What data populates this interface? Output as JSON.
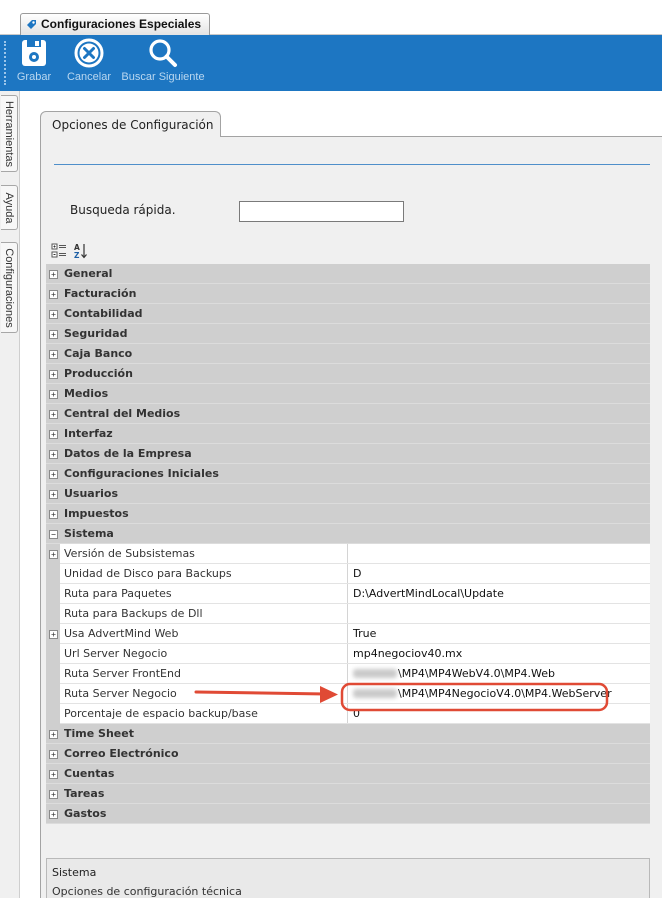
{
  "window": {
    "tab_title": "Configuraciones Especiales"
  },
  "toolbar": {
    "save_label": "Grabar",
    "cancel_label": "Cancelar",
    "find_next_label": "Buscar Siguiente"
  },
  "left_dock": {
    "tabs": [
      "Herramientas",
      "Ayuda",
      "Configuraciones"
    ]
  },
  "options_tab": {
    "title": "Opciones de Configuración"
  },
  "search": {
    "label": "Busqueda rápida.",
    "value": ""
  },
  "grid": {
    "categories_top": [
      "General",
      "Facturación",
      "Contabilidad",
      "Seguridad",
      "Caja Banco",
      "Producción",
      "Medios",
      "Central del Medios",
      "Interfaz",
      "Datos de la Empresa",
      "Configuraciones Iniciales",
      "Usuarios",
      "Impuestos"
    ],
    "expanded_category": "Sistema",
    "properties": [
      {
        "name": "Versión de Subsistemas",
        "value": "",
        "expandable": true
      },
      {
        "name": "Unidad de Disco para Backups",
        "value": "D",
        "expandable": false
      },
      {
        "name": "Ruta para Paquetes",
        "value": "D:\\AdvertMindLocal\\Update",
        "expandable": false
      },
      {
        "name": "Ruta para Backups de Dll",
        "value": "",
        "expandable": false
      },
      {
        "name": "Usa AdvertMind Web",
        "value": "True",
        "expandable": true
      },
      {
        "name": "Url Server Negocio",
        "value": "mp4negociov40.mx",
        "expandable": false
      },
      {
        "name": "Ruta Server FrontEnd",
        "value": "\\MP4\\MP4WebV4.0\\MP4.Web",
        "expandable": false
      },
      {
        "name": "Ruta Server Negocio",
        "value": "\\MP4\\MP4NegocioV4.0\\MP4.WebServer",
        "expandable": false
      },
      {
        "name": "Porcentaje de espacio backup/base",
        "value": "0",
        "expandable": false
      }
    ],
    "categories_bottom": [
      "Time Sheet",
      "Correo Electrónico",
      "Cuentas",
      "Tareas",
      "Gastos"
    ]
  },
  "description": {
    "title": "Sistema",
    "text": "Opciones de configuración técnica"
  },
  "colors": {
    "toolbar_blue": "#1d76c2",
    "annotation_red": "#e04a35",
    "category_gray": "#cfcfcf"
  }
}
